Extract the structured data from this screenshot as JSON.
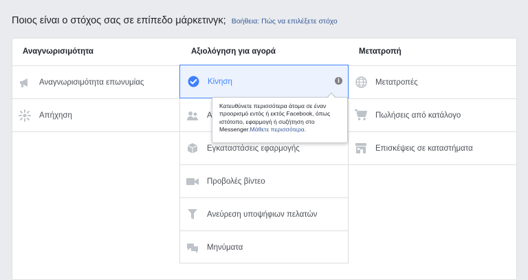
{
  "header": {
    "question": "Ποιος είναι ο στόχος σας σε επίπεδο μάρκετινγκ;",
    "help_link": "Βοήθεια: Πώς να επιλέξετε στόχο"
  },
  "columns": [
    {
      "title": "Αναγνωρισιμότητα",
      "items": [
        {
          "label": "Αναγνωρισιμότητα επωνυμίας",
          "icon": "megaphone-icon"
        },
        {
          "label": "Απήχηση",
          "icon": "reach-burst-icon"
        }
      ]
    },
    {
      "title": "Αξιολόγηση για αγορά",
      "items": [
        {
          "label": "Κίνηση",
          "icon": "checkmark-circle-icon",
          "selected": true
        },
        {
          "label": "Α",
          "icon": "people-icon"
        },
        {
          "label": "Εγκαταστάσεις εφαρμογής",
          "icon": "box-icon"
        },
        {
          "label": "Προβολές βίντεο",
          "icon": "video-camera-icon"
        },
        {
          "label": "Ανεύρεση υποψήφιων πελατών",
          "icon": "funnel-icon"
        },
        {
          "label": "Μηνύματα",
          "icon": "chat-bubbles-icon"
        }
      ]
    },
    {
      "title": "Μετατροπή",
      "items": [
        {
          "label": "Μετατροπές",
          "icon": "globe-icon"
        },
        {
          "label": "Πωλήσεις από κατάλογο",
          "icon": "shopping-cart-icon"
        },
        {
          "label": "Επισκέψεις σε καταστήματα",
          "icon": "store-icon"
        }
      ]
    }
  ],
  "tooltip": {
    "text": "Κατευθύνετε περισσότερα άτομα σε έναν προορισμό εντός ή εκτός Facebook, όπως ιστότοπο, εφαρμογή ή συζήτηση στο Messenger.",
    "link": "Μάθετε περισσότερα."
  },
  "colors": {
    "accent": "#4080ff",
    "selected_bg": "#ecf3ff",
    "link": "#365899",
    "icon_gray": "#bec3c9"
  }
}
